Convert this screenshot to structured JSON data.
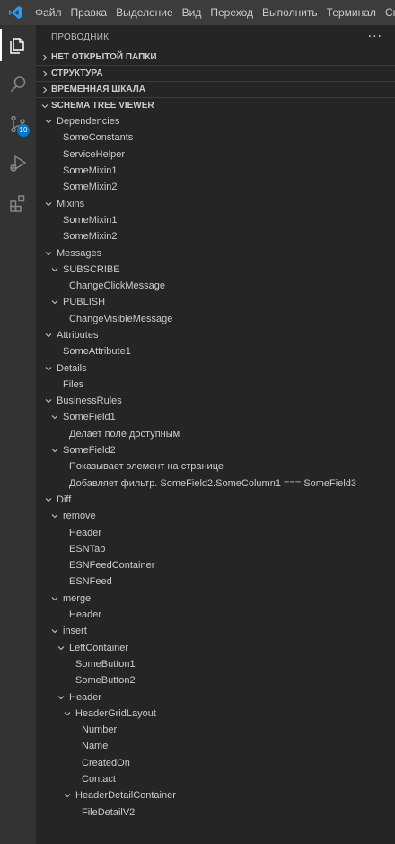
{
  "menu": [
    "Файл",
    "Правка",
    "Выделение",
    "Вид",
    "Переход",
    "Выполнить",
    "Терминал",
    "Справ"
  ],
  "activity": [
    {
      "name": "explorer-icon",
      "active": true
    },
    {
      "name": "search-icon",
      "active": false
    },
    {
      "name": "source-control-icon",
      "active": false,
      "badge": "10"
    },
    {
      "name": "run-debug-icon",
      "active": false
    },
    {
      "name": "extensions-icon",
      "active": false
    }
  ],
  "sidebar": {
    "title": "ПРОВОДНИК",
    "more": "···",
    "sections": [
      {
        "label": "НЕТ ОТКРЫТОЙ ПАПКИ",
        "expanded": false
      },
      {
        "label": "СТРУКТУРА",
        "expanded": false
      },
      {
        "label": "ВРЕМЕННАЯ ШКАЛА",
        "expanded": false
      },
      {
        "label": "SCHEMA TREE VIEWER",
        "expanded": true
      }
    ]
  },
  "tree": [
    {
      "label": "Dependencies",
      "depth": 0,
      "expandable": true
    },
    {
      "label": "SomeConstants",
      "depth": 1,
      "expandable": false
    },
    {
      "label": "ServiceHelper",
      "depth": 1,
      "expandable": false
    },
    {
      "label": "SomeMixin1",
      "depth": 1,
      "expandable": false
    },
    {
      "label": "SomeMixin2",
      "depth": 1,
      "expandable": false
    },
    {
      "label": "Mixins",
      "depth": 0,
      "expandable": true
    },
    {
      "label": "SomeMixin1",
      "depth": 1,
      "expandable": false
    },
    {
      "label": "SomeMixin2",
      "depth": 1,
      "expandable": false
    },
    {
      "label": "Messages",
      "depth": 0,
      "expandable": true
    },
    {
      "label": "SUBSCRIBE",
      "depth": 1,
      "expandable": true
    },
    {
      "label": "ChangeClickMessage",
      "depth": 2,
      "expandable": false
    },
    {
      "label": "PUBLISH",
      "depth": 1,
      "expandable": true
    },
    {
      "label": "ChangeVisibleMessage",
      "depth": 2,
      "expandable": false
    },
    {
      "label": "Attributes",
      "depth": 0,
      "expandable": true
    },
    {
      "label": "SomeAttribute1",
      "depth": 1,
      "expandable": false
    },
    {
      "label": "Details",
      "depth": 0,
      "expandable": true
    },
    {
      "label": "Files",
      "depth": 1,
      "expandable": false
    },
    {
      "label": "BusinessRules",
      "depth": 0,
      "expandable": true
    },
    {
      "label": "SomeField1",
      "depth": 1,
      "expandable": true
    },
    {
      "label": "Делает поле доступным",
      "depth": 2,
      "expandable": false
    },
    {
      "label": "SomeField2",
      "depth": 1,
      "expandable": true
    },
    {
      "label": "Показывает элемент на странице",
      "depth": 2,
      "expandable": false
    },
    {
      "label": "Добавляет фильтр. SomeField2.SomeColumn1 === SomeField3",
      "depth": 2,
      "expandable": false
    },
    {
      "label": "Diff",
      "depth": 0,
      "expandable": true
    },
    {
      "label": "remove",
      "depth": 1,
      "expandable": true
    },
    {
      "label": "Header",
      "depth": 2,
      "expandable": false
    },
    {
      "label": "ESNTab",
      "depth": 2,
      "expandable": false
    },
    {
      "label": "ESNFeedContainer",
      "depth": 2,
      "expandable": false
    },
    {
      "label": "ESNFeed",
      "depth": 2,
      "expandable": false
    },
    {
      "label": "merge",
      "depth": 1,
      "expandable": true
    },
    {
      "label": "Header",
      "depth": 2,
      "expandable": false
    },
    {
      "label": "insert",
      "depth": 1,
      "expandable": true
    },
    {
      "label": "LeftContainer",
      "depth": 2,
      "expandable": true
    },
    {
      "label": "SomeButton1",
      "depth": 3,
      "expandable": false
    },
    {
      "label": "SomeButton2",
      "depth": 3,
      "expandable": false
    },
    {
      "label": "Header",
      "depth": 2,
      "expandable": true
    },
    {
      "label": "HeaderGridLayout",
      "depth": 3,
      "expandable": true
    },
    {
      "label": "Number",
      "depth": 4,
      "expandable": false
    },
    {
      "label": "Name",
      "depth": 4,
      "expandable": false
    },
    {
      "label": "CreatedOn",
      "depth": 4,
      "expandable": false
    },
    {
      "label": "Contact",
      "depth": 4,
      "expandable": false
    },
    {
      "label": "HeaderDetailContainer",
      "depth": 3,
      "expandable": true
    },
    {
      "label": "FileDetailV2",
      "depth": 4,
      "expandable": false
    }
  ]
}
